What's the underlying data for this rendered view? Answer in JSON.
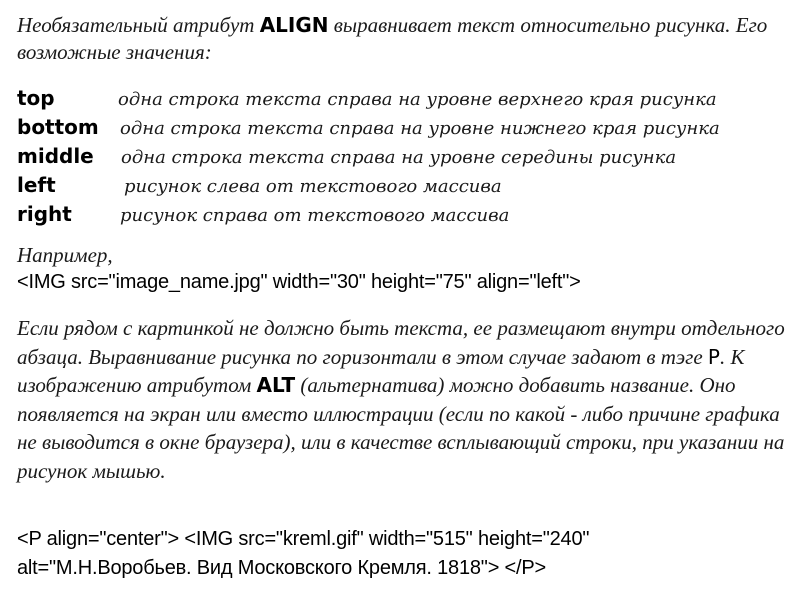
{
  "intro": {
    "before": "Необязательный атрибут ",
    "keyword": "ALIGN",
    "after": " выравнивает текст относительно рисунка. Его возможные значения:"
  },
  "align_values": [
    {
      "key": "top",
      "description": "одна строка текста справа на уровне верхнего края рисунка"
    },
    {
      "key": "bottom",
      "description": "одна строка текста справа на уровне нижнего края рисунка"
    },
    {
      "key": "middle",
      "description": "одна строка текста справа на уровне середины рисунка"
    },
    {
      "key": "left",
      "description": "рисунок слева от текстового массива"
    },
    {
      "key": "right",
      "description": "рисунок справа от текстового массива"
    }
  ],
  "example": {
    "label": "Например,",
    "code": "<IMG src=\"image_name.jpg\" width=\"30\" height=\"75\" align=\"left\">"
  },
  "body": {
    "part1": "Если рядом с картинкой не должно быть текста, ее размещают внутри отдельного абзаца. Выравнивание рисунка по горизонтали в этом случае задают в тэге ",
    "tag": "P",
    "part2": ". К изображению атрибутом ",
    "keyword": "ALT",
    "part3": " (альтернатива) можно добавить название. Оно появляется на экран или вместо иллюстрации (если по какой - либо причине графика не выводится в окне браузера), или в качестве всплывающий строки, при указании на рисунок мышью."
  },
  "final_code": {
    "line1": "<P align=\"center\"> <IMG src=\"kreml.gif\" width=\"515\" height=\"240\"",
    "line2": "alt=\"М.Н.Воробьев. Вид Московского Кремля. 1818\"> </P>"
  }
}
